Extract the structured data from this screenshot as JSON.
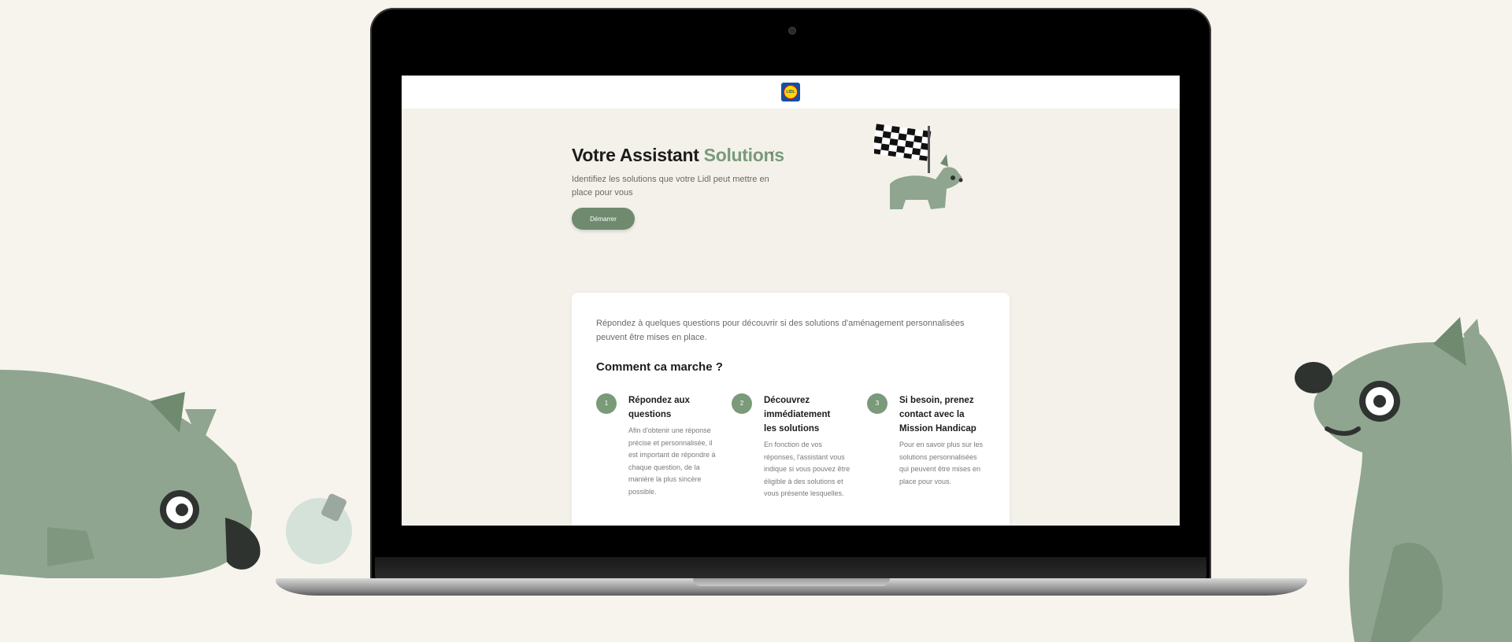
{
  "screen": {
    "logo_text": "LIDL",
    "hero": {
      "title": "Votre Assistant",
      "title_accent": "Solutions",
      "subtitle": "Identifiez les solutions que votre Lidl peut mettre en place pour vous",
      "start_label": "Démarrer"
    },
    "card": {
      "intro": "Répondez à quelques questions pour découvrir si des solutions d'aménagement personnalisées peuvent être mises en place.",
      "how_title": "Comment ca marche ?",
      "steps": [
        {
          "num": "1",
          "title": "Répondez aux questions",
          "text": "Afin d'obtenir une réponse précise et personnalisée, il est important de répondre à chaque question, de la manière la plus sincère possible."
        },
        {
          "num": "2",
          "title": "Découvrez immédiatement les solutions",
          "text": "En fonction de vos réponses, l'assistant vous indique si vous pouvez être éligible à des solutions et vous présente lesquelles."
        },
        {
          "num": "3",
          "title": "Si besoin, prenez contact avec la Mission Handicap",
          "text": "Pour en savoir plus sur les solutions personnalisées qui peuvent être mises en place pour vous."
        }
      ]
    }
  },
  "colors": {
    "background": "#f7f4ee",
    "accent_green": "#7a9a7a",
    "creature_green": "#8fa58f",
    "dark_text": "#1c1c1c"
  }
}
